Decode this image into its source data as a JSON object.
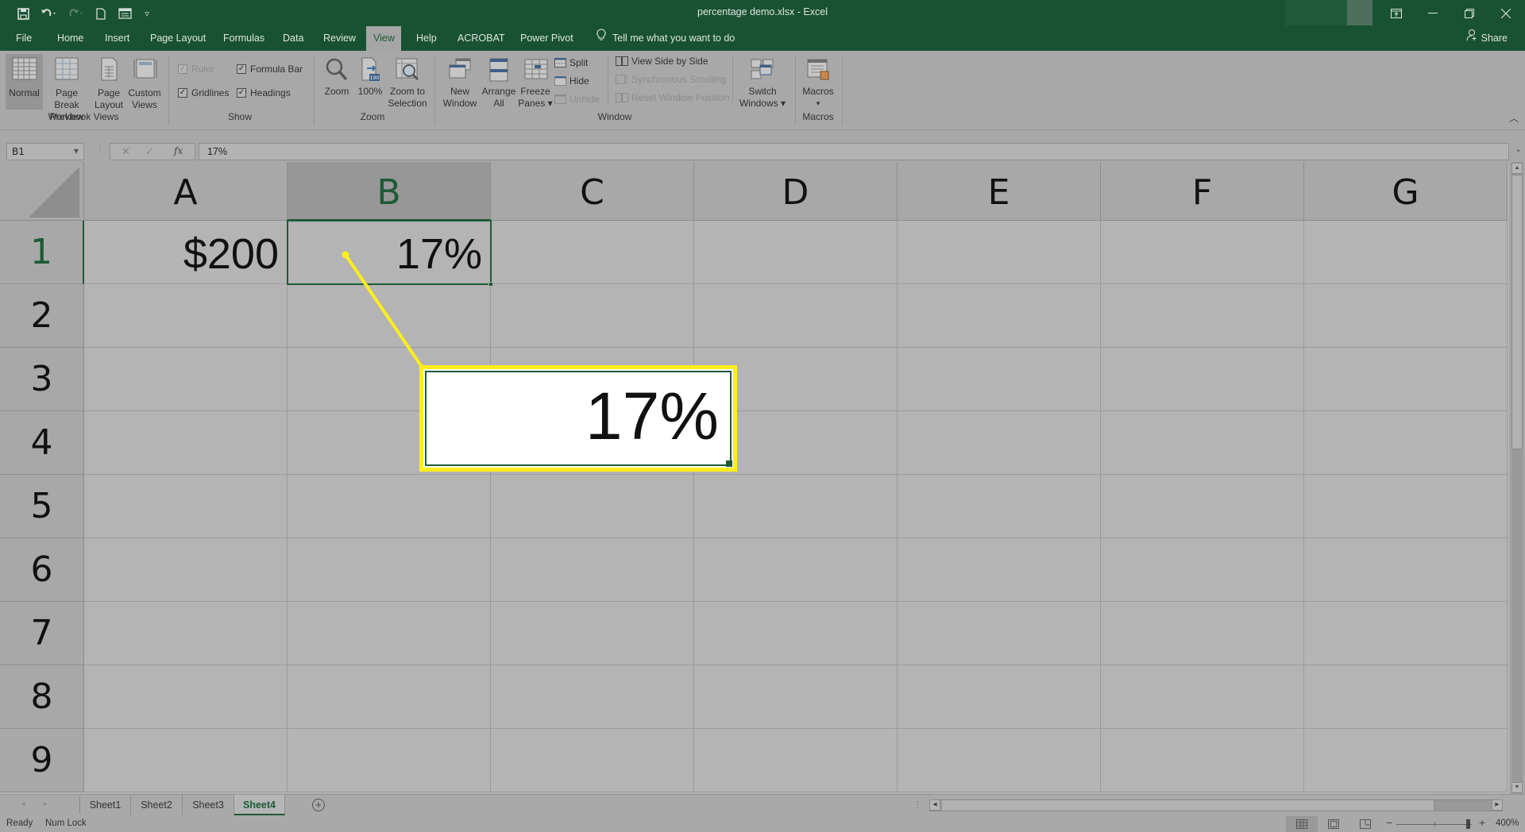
{
  "app": {
    "title": "percentage demo.xlsx  -  Excel",
    "accent_color": "#185232",
    "callout_color": "#ffee1a"
  },
  "quick_access": [
    {
      "name": "save-icon",
      "glyph": "💾"
    },
    {
      "name": "undo-icon",
      "glyph": "↶▾"
    },
    {
      "name": "redo-icon",
      "glyph": "↷▾"
    },
    {
      "name": "new-file-icon",
      "glyph": "🗋"
    },
    {
      "name": "form-icon",
      "glyph": "☷"
    },
    {
      "name": "customize-qat-icon",
      "glyph": "▿"
    }
  ],
  "window_controls": {
    "ribbon_display": "⤒",
    "minimize": "—",
    "restore": "❐",
    "close": "✕"
  },
  "ribbon_tabs": [
    {
      "label": "File"
    },
    {
      "label": "Home"
    },
    {
      "label": "Insert"
    },
    {
      "label": "Page Layout"
    },
    {
      "label": "Formulas"
    },
    {
      "label": "Data"
    },
    {
      "label": "Review"
    },
    {
      "label": "View",
      "active": true
    },
    {
      "label": "Help"
    },
    {
      "label": "ACROBAT"
    },
    {
      "label": "Power Pivot"
    }
  ],
  "tell_me": "Tell me what you want to do",
  "share_label": "Share",
  "ribbon": {
    "workbook_views": {
      "group_label": "Workbook Views",
      "normal": "Normal",
      "page_break_1": "Page Break",
      "page_break_2": "Preview",
      "page_layout_1": "Page",
      "page_layout_2": "Layout",
      "custom_views_1": "Custom",
      "custom_views_2": "Views"
    },
    "show": {
      "group_label": "Show",
      "ruler": {
        "label": "Ruler",
        "checked": true,
        "disabled": true
      },
      "formula_bar": {
        "label": "Formula Bar",
        "checked": true
      },
      "gridlines": {
        "label": "Gridlines",
        "checked": true
      },
      "headings": {
        "label": "Headings",
        "checked": true
      }
    },
    "zoom": {
      "group_label": "Zoom",
      "zoom": "Zoom",
      "hundred": "100%",
      "hundred_badge": "100",
      "zoom_sel_1": "Zoom to",
      "zoom_sel_2": "Selection"
    },
    "window": {
      "group_label": "Window",
      "new_window_1": "New",
      "new_window_2": "Window",
      "arrange_1": "Arrange",
      "arrange_2": "All",
      "freeze_1": "Freeze",
      "freeze_2": "Panes ▾",
      "split": "Split",
      "hide": "Hide",
      "unhide": "Unhide",
      "side_by_side": "View Side by Side",
      "sync_scroll": "Synchronous Scrolling",
      "reset_position": "Reset Window Position",
      "switch_1": "Switch",
      "switch_2": "Windows ▾"
    },
    "macros": {
      "group_label": "Macros",
      "macros_1": "Macros",
      "macros_2": "▾"
    }
  },
  "formula_bar": {
    "name_box": "B1",
    "cancel": "✕",
    "enter": "✓",
    "fx": "fx",
    "value": "17%"
  },
  "grid": {
    "columns": [
      "A",
      "B",
      "C",
      "D",
      "E",
      "F",
      "G"
    ],
    "rows": [
      "1",
      "2",
      "3",
      "4",
      "5",
      "6",
      "7",
      "8",
      "9"
    ],
    "selected_cell": "B1",
    "cells": {
      "A1": "$200",
      "B1": "17%"
    }
  },
  "callout": {
    "value": "17%"
  },
  "sheet_tabs": [
    {
      "label": "Sheet1"
    },
    {
      "label": "Sheet2"
    },
    {
      "label": "Sheet3"
    },
    {
      "label": "Sheet4",
      "active": true
    }
  ],
  "status_bar": {
    "ready": "Ready",
    "num_lock": "Num Lock",
    "zoom_level": "400%",
    "zoom_fraction": 0.95
  }
}
